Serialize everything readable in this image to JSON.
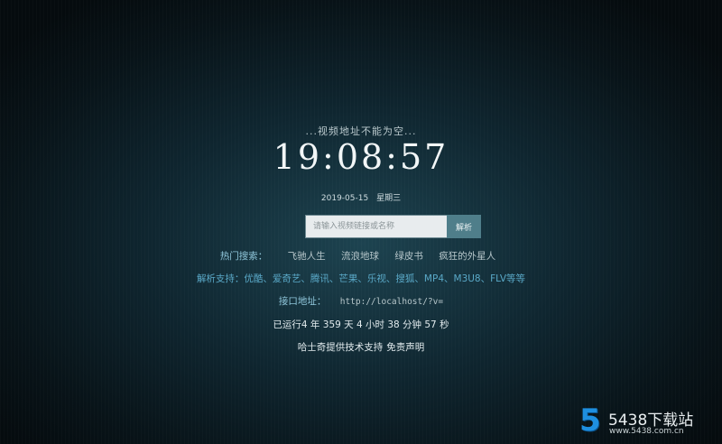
{
  "notice": "...视频地址不能为空...",
  "clock": "19:08:57",
  "date": {
    "day": "2019-05-15",
    "weekday": "星期三"
  },
  "search": {
    "placeholder": "请输入视频链接或名称",
    "button_label": "解析"
  },
  "hot": {
    "label": "热门搜索：",
    "items": [
      "飞驰人生",
      "流浪地球",
      "绿皮书",
      "疯狂的外星人"
    ]
  },
  "support": {
    "text": "解析支持：优酷、爱奇艺、腾讯、芒果、乐视、搜狐、MP4、M3U8、FLV等等"
  },
  "api": {
    "label": "接口地址：",
    "value": "http://localhost/?v="
  },
  "uptime": "已运行4 年 359 天 4 小时 38 分钟 57 秒",
  "footer": {
    "text": "哈士奇提供技术支持",
    "disclaimer": "免责声明"
  },
  "watermark": {
    "logo": "5",
    "title": "5438下载站",
    "url": "www.5438.com.cn"
  }
}
